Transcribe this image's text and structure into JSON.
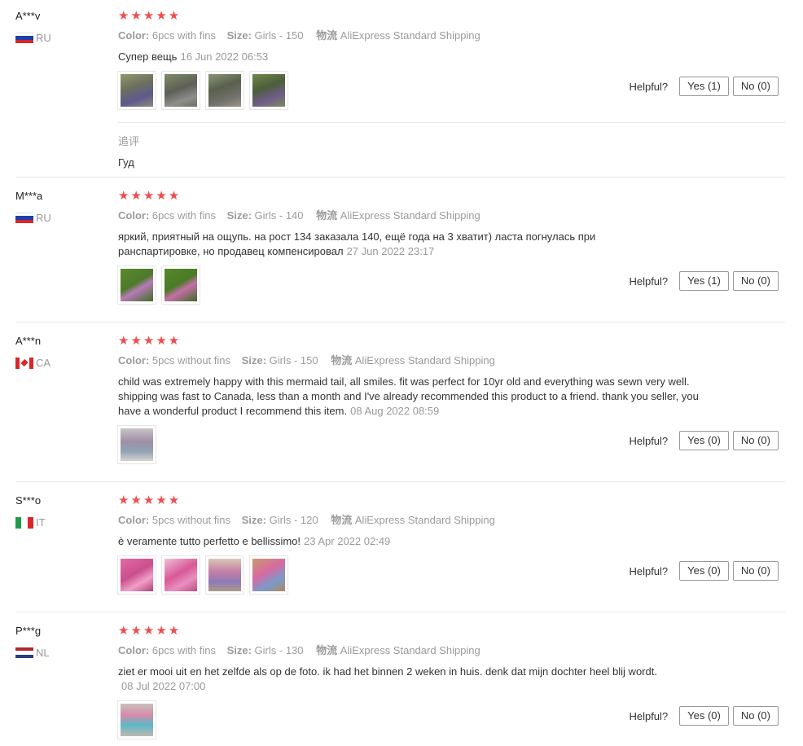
{
  "labels": {
    "color": "Color:",
    "size": "Size:",
    "shipping": "物流",
    "helpful": "Helpful?"
  },
  "stars": "★★★★★",
  "reviews": [
    {
      "user": "A***v",
      "country": "RU",
      "flag": "russia-flag-icon",
      "rating": 5,
      "color": "6pcs with fins",
      "size": "Girls - 150",
      "shipping": "AliExpress Standard Shipping",
      "text": "Супер вещь",
      "date": "16 Jun 2022 06:53",
      "photos": 4,
      "yes": "Yes (1)",
      "no": "No (0)",
      "followup_label": "追评",
      "followup_text": "Гуд"
    },
    {
      "user": "M***a",
      "country": "RU",
      "flag": "russia-flag-icon",
      "rating": 5,
      "color": "6pcs with fins",
      "size": "Girls - 140",
      "shipping": "AliExpress Standard Shipping",
      "text": "яркий, приятный на ощупь. на рост 134 заказала 140, ещё года на 3 хватит) ласта погнулась при ранспартировке, но продавец компенсировал",
      "date": "27 Jun 2022 23:17",
      "photos": 2,
      "yes": "Yes (1)",
      "no": "No (0)"
    },
    {
      "user": "A***n",
      "country": "CA",
      "flag": "canada-flag-icon",
      "rating": 5,
      "color": "5pcs without fins",
      "size": "Girls - 150",
      "shipping": "AliExpress Standard Shipping",
      "text": "child was extremely happy with this mermaid tail, all smiles. fit was perfect for 10yr old and everything was sewn very well. shipping was fast to Canada, less than a month and I've already recommended this product to a friend. thank you seller, you have a wonderful product I recommend this item.",
      "date": "08 Aug 2022 08:59",
      "photos": 1,
      "yes": "Yes (0)",
      "no": "No (0)"
    },
    {
      "user": "S***o",
      "country": "IT",
      "flag": "italy-flag-icon",
      "rating": 5,
      "color": "5pcs without fins",
      "size": "Girls - 120",
      "shipping": "AliExpress Standard Shipping",
      "text": "è veramente tutto perfetto e bellissimo!",
      "date": "23 Apr 2022 02:49",
      "photos": 4,
      "yes": "Yes (0)",
      "no": "No (0)"
    },
    {
      "user": "P***g",
      "country": "NL",
      "flag": "netherlands-flag-icon",
      "rating": 5,
      "color": "6pcs with fins",
      "size": "Girls - 130",
      "shipping": "AliExpress Standard Shipping",
      "text": "ziet er mooi uit en het zelfde als op de foto. ik had het binnen 2 weken in huis. denk dat mijn dochter heel blij wordt.",
      "date": "08 Jul 2022 07:00",
      "photos": 1,
      "yes": "Yes (0)",
      "no": "No (0)"
    }
  ],
  "colors": {
    "star": "#ee4e4e",
    "muted": "#9b9b9b",
    "divider": "#e8e8e8"
  }
}
